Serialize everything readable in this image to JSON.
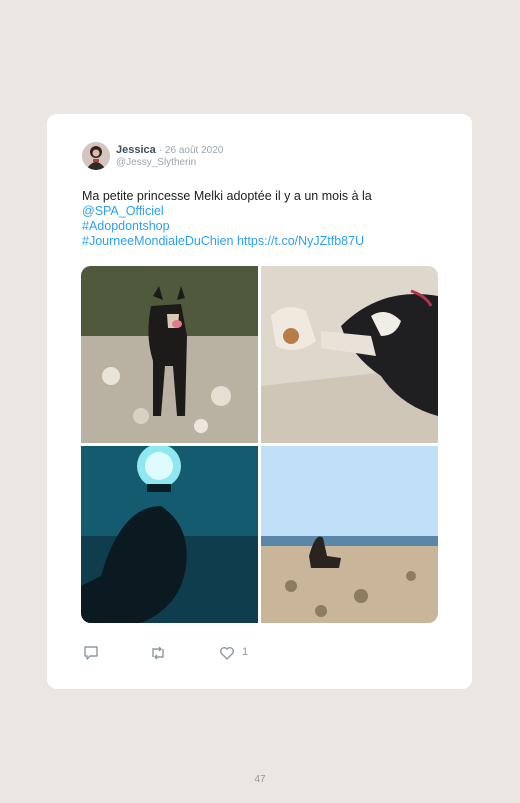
{
  "tweet": {
    "author_name": "Jessica",
    "date": "· 26 août 2020",
    "handle": "@Jessy_Slytherin",
    "text_line1": "Ma petite princesse Melki adoptée il y a un mois à la",
    "mention": "@SPA_Officiel",
    "hashtag1": "#Adopdontshop",
    "hashtag2": "#JourneeMondialeDuChien",
    "url": "https://t.co/NyJZtfb87U",
    "likes": "1"
  },
  "icons": [
    "reply-icon",
    "retweet-icon",
    "heart-icon"
  ],
  "colors": {
    "background": "#ece6e2",
    "card": "#ffffff",
    "link": "#2ea0f2",
    "name": "#3d4f63",
    "meta": "#9aa5b1"
  },
  "page_number": "47"
}
